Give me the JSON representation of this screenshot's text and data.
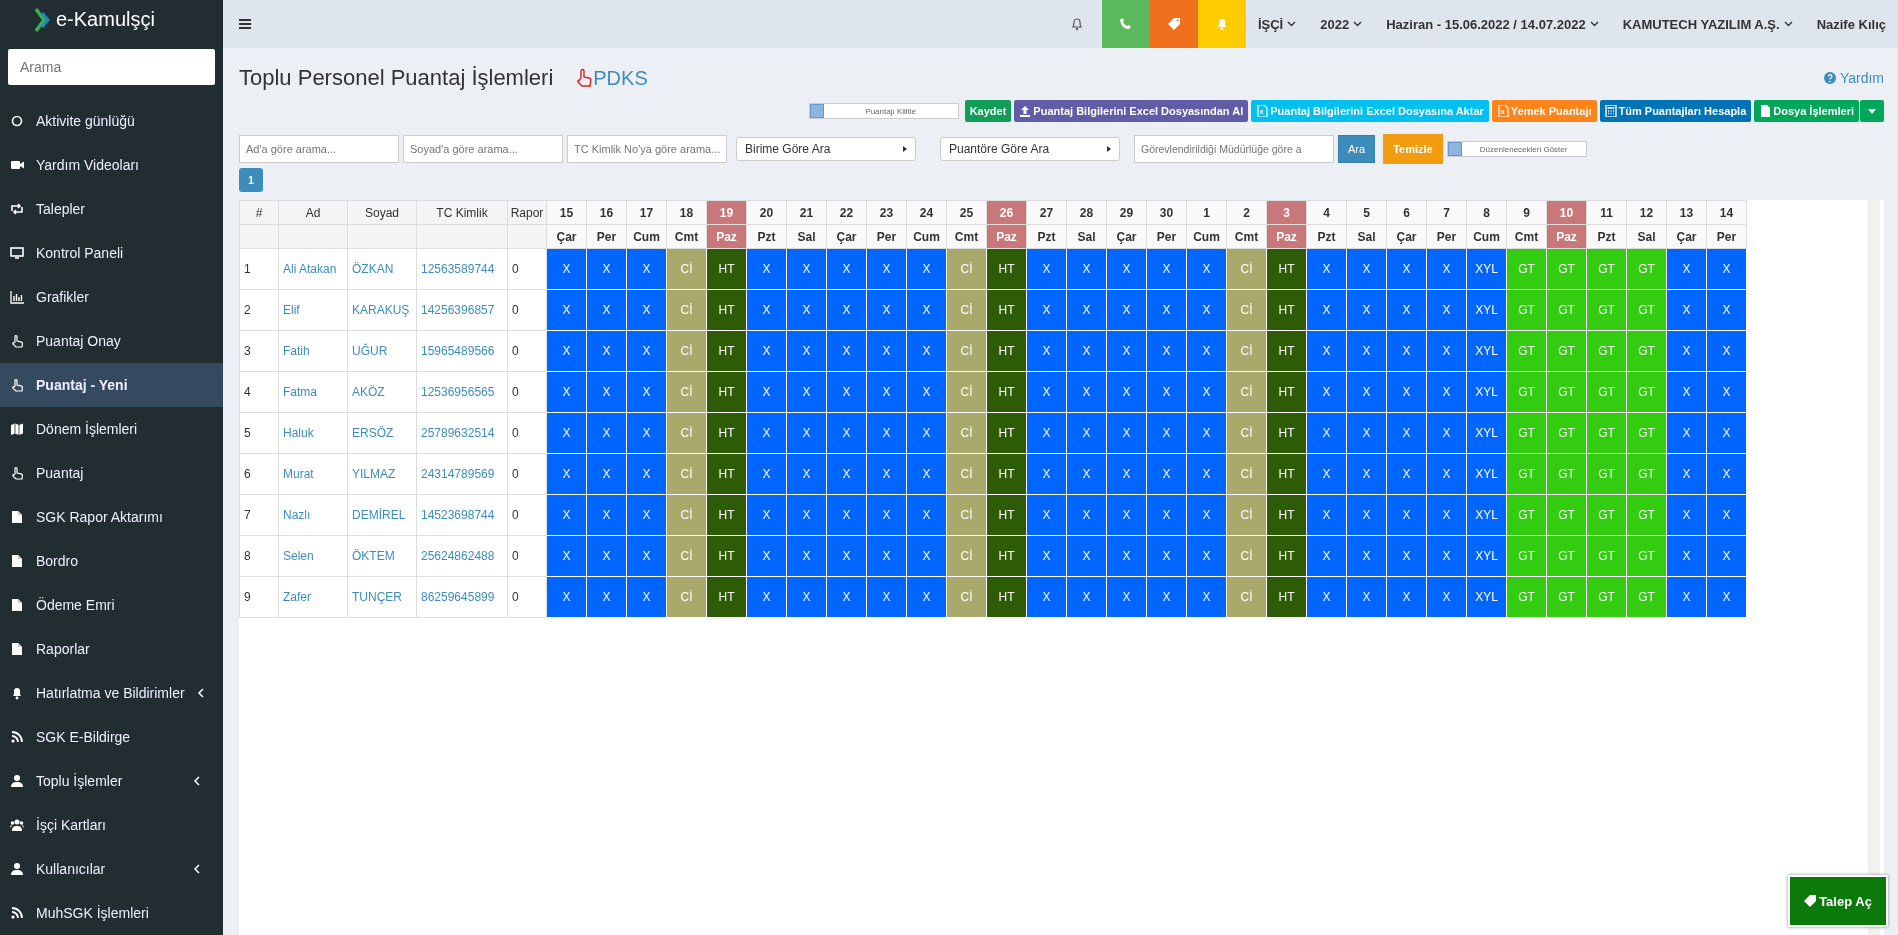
{
  "brand": {
    "name": "e-Kamulşçi"
  },
  "sidebar": {
    "search": {
      "placeholder": "Arama"
    },
    "items": [
      {
        "label": "Aktivite günlüğü",
        "selected": false,
        "has_submenu": false
      },
      {
        "label": "Yardım Videoları",
        "selected": false,
        "has_submenu": false
      },
      {
        "label": "Talepler",
        "selected": false,
        "has_submenu": false
      },
      {
        "label": "Kontrol Paneli",
        "selected": false,
        "has_submenu": false
      },
      {
        "label": "Grafikler",
        "selected": false,
        "has_submenu": false
      },
      {
        "label": "Puantaj Onay",
        "selected": false,
        "has_submenu": false
      },
      {
        "label": "Puantaj - Yeni",
        "selected": true,
        "has_submenu": false
      },
      {
        "label": "Dönem İşlemleri",
        "selected": false,
        "has_submenu": false
      },
      {
        "label": "Puantaj",
        "selected": false,
        "has_submenu": false
      },
      {
        "label": "SGK Rapor Aktarımı",
        "selected": false,
        "has_submenu": false
      },
      {
        "label": "Bordro",
        "selected": false,
        "has_submenu": false
      },
      {
        "label": "Ödeme Emri",
        "selected": false,
        "has_submenu": false
      },
      {
        "label": "Raporlar",
        "selected": false,
        "has_submenu": false
      },
      {
        "label": "Hatırlatma ve Bildirimler",
        "selected": false,
        "has_submenu": true
      },
      {
        "label": "SGK E-Bildirge",
        "selected": false,
        "has_submenu": false
      },
      {
        "label": "Toplu İşlemler",
        "selected": false,
        "has_submenu": true
      },
      {
        "label": "İşçi Kartları",
        "selected": false,
        "has_submenu": false
      },
      {
        "label": "Kullanıcılar",
        "selected": false,
        "has_submenu": true
      },
      {
        "label": "MuhSGK İşlemleri",
        "selected": false,
        "has_submenu": false
      }
    ]
  },
  "topbar": {
    "menus": [
      {
        "label": "İŞÇİ"
      },
      {
        "label": "2022"
      },
      {
        "label": "Haziran - 15.06.2022 / 14.07.2022"
      },
      {
        "label": "KAMUTECH YAZILIM A.Ş."
      }
    ],
    "user": "Nazife Kılıç"
  },
  "page": {
    "title": "Toplu Personel Puantaj İşlemleri",
    "pdks_link": "PDKS",
    "help": "Yardım"
  },
  "toolbar": {
    "lock_toggle": {
      "label": "Puantajı Kilitle",
      "on": false
    },
    "buttons": [
      {
        "label": "Kaydet",
        "color": "#0f9d58"
      },
      {
        "label": "Puantaj Bilgilerini Excel Dosyasından Al",
        "color": "#605ca8"
      },
      {
        "label": "Puantaj Bilgilerini Excel Dosyasına Aktar",
        "color": "#00c0ef"
      },
      {
        "label": "Yemek Puantajı",
        "color": "#ff851b"
      },
      {
        "label": "Tüm Puantajları Hesapla",
        "color": "#0073b7"
      },
      {
        "label": "Dosya İşlemleri",
        "color": "#00a65a"
      }
    ]
  },
  "filters": {
    "fields": [
      {
        "placeholder": "Ad'a göre arama..."
      },
      {
        "placeholder": "Soyad'a göre arama..."
      },
      {
        "placeholder": "TC Kimlik No'ya göre arama..."
      }
    ],
    "selects": [
      {
        "label": "Birime Göre Ara"
      },
      {
        "label": "Puantöre Göre Ara"
      }
    ],
    "manager_field": {
      "placeholder": "Görevlendirildiği Müdürlüğe göre a"
    },
    "search_button": "Ara",
    "clear_button": "Temizle",
    "show_toggle": {
      "label": "Düzenlenecekleri Göster",
      "on": false
    }
  },
  "pagination": [
    {
      "label": "1",
      "selected": true
    }
  ],
  "table": {
    "columns": [
      "#",
      "Ad",
      "Soyad",
      "TC Kimlik",
      "Rapor"
    ],
    "days": [
      {
        "day": "15",
        "weekday": "Çar",
        "holiday": false
      },
      {
        "day": "16",
        "weekday": "Per",
        "holiday": false
      },
      {
        "day": "17",
        "weekday": "Cum",
        "holiday": false
      },
      {
        "day": "18",
        "weekday": "Cmt",
        "holiday": false
      },
      {
        "day": "19",
        "weekday": "Paz",
        "holiday": true
      },
      {
        "day": "20",
        "weekday": "Pzt",
        "holiday": false
      },
      {
        "day": "21",
        "weekday": "Sal",
        "holiday": false
      },
      {
        "day": "22",
        "weekday": "Çar",
        "holiday": false
      },
      {
        "day": "23",
        "weekday": "Per",
        "holiday": false
      },
      {
        "day": "24",
        "weekday": "Cum",
        "holiday": false
      },
      {
        "day": "25",
        "weekday": "Cmt",
        "holiday": false
      },
      {
        "day": "26",
        "weekday": "Paz",
        "holiday": true
      },
      {
        "day": "27",
        "weekday": "Pzt",
        "holiday": false
      },
      {
        "day": "28",
        "weekday": "Sal",
        "holiday": false
      },
      {
        "day": "29",
        "weekday": "Çar",
        "holiday": false
      },
      {
        "day": "30",
        "weekday": "Per",
        "holiday": false
      },
      {
        "day": "1",
        "weekday": "Cum",
        "holiday": false
      },
      {
        "day": "2",
        "weekday": "Cmt",
        "holiday": false
      },
      {
        "day": "3",
        "weekday": "Paz",
        "holiday": true
      },
      {
        "day": "4",
        "weekday": "Pzt",
        "holiday": false
      },
      {
        "day": "5",
        "weekday": "Sal",
        "holiday": false
      },
      {
        "day": "6",
        "weekday": "Çar",
        "holiday": false
      },
      {
        "day": "7",
        "weekday": "Per",
        "holiday": false
      },
      {
        "day": "8",
        "weekday": "Cum",
        "holiday": false
      },
      {
        "day": "9",
        "weekday": "Cmt",
        "holiday": false
      },
      {
        "day": "10",
        "weekday": "Paz",
        "holiday": true
      },
      {
        "day": "11",
        "weekday": "Pzt",
        "holiday": false
      },
      {
        "day": "12",
        "weekday": "Sal",
        "holiday": false
      },
      {
        "day": "13",
        "weekday": "Çar",
        "holiday": false
      },
      {
        "day": "14",
        "weekday": "Per",
        "holiday": false
      }
    ],
    "rows": [
      {
        "no": "1",
        "ad": "Ali Atakan",
        "soyad": "ÖZKAN",
        "tc": "12563589744",
        "rapor": "0",
        "cells": [
          {
            "code": "X",
            "color": "#0066ff"
          },
          {
            "code": "X",
            "color": "#0066ff"
          },
          {
            "code": "X",
            "color": "#0066ff"
          },
          {
            "code": "Cİ",
            "color": "#a9a96c"
          },
          {
            "code": "HT",
            "color": "#2e5b06"
          },
          {
            "code": "X",
            "color": "#0066ff"
          },
          {
            "code": "X",
            "color": "#0066ff"
          },
          {
            "code": "X",
            "color": "#0066ff"
          },
          {
            "code": "X",
            "color": "#0066ff"
          },
          {
            "code": "X",
            "color": "#0066ff"
          },
          {
            "code": "Cİ",
            "color": "#a9a96c"
          },
          {
            "code": "HT",
            "color": "#2e5b06"
          },
          {
            "code": "X",
            "color": "#0066ff"
          },
          {
            "code": "X",
            "color": "#0066ff"
          },
          {
            "code": "X",
            "color": "#0066ff"
          },
          {
            "code": "X",
            "color": "#0066ff"
          },
          {
            "code": "X",
            "color": "#0066ff"
          },
          {
            "code": "Cİ",
            "color": "#a9a96c"
          },
          {
            "code": "HT",
            "color": "#2e5b06"
          },
          {
            "code": "X",
            "color": "#0066ff"
          },
          {
            "code": "X",
            "color": "#0066ff"
          },
          {
            "code": "X",
            "color": "#0066ff"
          },
          {
            "code": "X",
            "color": "#0066ff"
          },
          {
            "code": "XYL",
            "color": "#0066ff"
          },
          {
            "code": "GT",
            "color": "#33cc11"
          },
          {
            "code": "GT",
            "color": "#33cc11"
          },
          {
            "code": "GT",
            "color": "#33cc11"
          },
          {
            "code": "GT",
            "color": "#33cc11"
          },
          {
            "code": "X",
            "color": "#0066ff"
          },
          {
            "code": "X",
            "color": "#0066ff"
          }
        ]
      },
      {
        "no": "2",
        "ad": "Elif",
        "soyad": "KARAKUŞ",
        "tc": "14256396857",
        "rapor": "0",
        "cells": [
          {
            "code": "X",
            "color": "#0066ff"
          },
          {
            "code": "X",
            "color": "#0066ff"
          },
          {
            "code": "X",
            "color": "#0066ff"
          },
          {
            "code": "Cİ",
            "color": "#a9a96c"
          },
          {
            "code": "HT",
            "color": "#2e5b06"
          },
          {
            "code": "X",
            "color": "#0066ff"
          },
          {
            "code": "X",
            "color": "#0066ff"
          },
          {
            "code": "X",
            "color": "#0066ff"
          },
          {
            "code": "X",
            "color": "#0066ff"
          },
          {
            "code": "X",
            "color": "#0066ff"
          },
          {
            "code": "Cİ",
            "color": "#a9a96c"
          },
          {
            "code": "HT",
            "color": "#2e5b06"
          },
          {
            "code": "X",
            "color": "#0066ff"
          },
          {
            "code": "X",
            "color": "#0066ff"
          },
          {
            "code": "X",
            "color": "#0066ff"
          },
          {
            "code": "X",
            "color": "#0066ff"
          },
          {
            "code": "X",
            "color": "#0066ff"
          },
          {
            "code": "Cİ",
            "color": "#a9a96c"
          },
          {
            "code": "HT",
            "color": "#2e5b06"
          },
          {
            "code": "X",
            "color": "#0066ff"
          },
          {
            "code": "X",
            "color": "#0066ff"
          },
          {
            "code": "X",
            "color": "#0066ff"
          },
          {
            "code": "X",
            "color": "#0066ff"
          },
          {
            "code": "XYL",
            "color": "#0066ff"
          },
          {
            "code": "GT",
            "color": "#33cc11"
          },
          {
            "code": "GT",
            "color": "#33cc11"
          },
          {
            "code": "GT",
            "color": "#33cc11"
          },
          {
            "code": "GT",
            "color": "#33cc11"
          },
          {
            "code": "X",
            "color": "#0066ff"
          },
          {
            "code": "X",
            "color": "#0066ff"
          }
        ]
      },
      {
        "no": "3",
        "ad": "Fatih",
        "soyad": "UĞUR",
        "tc": "15965489566",
        "rapor": "0",
        "cells": [
          {
            "code": "X",
            "color": "#0066ff"
          },
          {
            "code": "X",
            "color": "#0066ff"
          },
          {
            "code": "X",
            "color": "#0066ff"
          },
          {
            "code": "Cİ",
            "color": "#a9a96c"
          },
          {
            "code": "HT",
            "color": "#2e5b06"
          },
          {
            "code": "X",
            "color": "#0066ff"
          },
          {
            "code": "X",
            "color": "#0066ff"
          },
          {
            "code": "X",
            "color": "#0066ff"
          },
          {
            "code": "X",
            "color": "#0066ff"
          },
          {
            "code": "X",
            "color": "#0066ff"
          },
          {
            "code": "Cİ",
            "color": "#a9a96c"
          },
          {
            "code": "HT",
            "color": "#2e5b06"
          },
          {
            "code": "X",
            "color": "#0066ff"
          },
          {
            "code": "X",
            "color": "#0066ff"
          },
          {
            "code": "X",
            "color": "#0066ff"
          },
          {
            "code": "X",
            "color": "#0066ff"
          },
          {
            "code": "X",
            "color": "#0066ff"
          },
          {
            "code": "Cİ",
            "color": "#a9a96c"
          },
          {
            "code": "HT",
            "color": "#2e5b06"
          },
          {
            "code": "X",
            "color": "#0066ff"
          },
          {
            "code": "X",
            "color": "#0066ff"
          },
          {
            "code": "X",
            "color": "#0066ff"
          },
          {
            "code": "X",
            "color": "#0066ff"
          },
          {
            "code": "XYL",
            "color": "#0066ff"
          },
          {
            "code": "GT",
            "color": "#33cc11"
          },
          {
            "code": "GT",
            "color": "#33cc11"
          },
          {
            "code": "GT",
            "color": "#33cc11"
          },
          {
            "code": "GT",
            "color": "#33cc11"
          },
          {
            "code": "X",
            "color": "#0066ff"
          },
          {
            "code": "X",
            "color": "#0066ff"
          }
        ]
      },
      {
        "no": "4",
        "ad": "Fatma",
        "soyad": "AKÖZ",
        "tc": "12536956565",
        "rapor": "0",
        "cells": [
          {
            "code": "X",
            "color": "#0066ff"
          },
          {
            "code": "X",
            "color": "#0066ff"
          },
          {
            "code": "X",
            "color": "#0066ff"
          },
          {
            "code": "Cİ",
            "color": "#a9a96c"
          },
          {
            "code": "HT",
            "color": "#2e5b06"
          },
          {
            "code": "X",
            "color": "#0066ff"
          },
          {
            "code": "X",
            "color": "#0066ff"
          },
          {
            "code": "X",
            "color": "#0066ff"
          },
          {
            "code": "X",
            "color": "#0066ff"
          },
          {
            "code": "X",
            "color": "#0066ff"
          },
          {
            "code": "Cİ",
            "color": "#a9a96c"
          },
          {
            "code": "HT",
            "color": "#2e5b06"
          },
          {
            "code": "X",
            "color": "#0066ff"
          },
          {
            "code": "X",
            "color": "#0066ff"
          },
          {
            "code": "X",
            "color": "#0066ff"
          },
          {
            "code": "X",
            "color": "#0066ff"
          },
          {
            "code": "X",
            "color": "#0066ff"
          },
          {
            "code": "Cİ",
            "color": "#a9a96c"
          },
          {
            "code": "HT",
            "color": "#2e5b06"
          },
          {
            "code": "X",
            "color": "#0066ff"
          },
          {
            "code": "X",
            "color": "#0066ff"
          },
          {
            "code": "X",
            "color": "#0066ff"
          },
          {
            "code": "X",
            "color": "#0066ff"
          },
          {
            "code": "XYL",
            "color": "#0066ff"
          },
          {
            "code": "GT",
            "color": "#33cc11"
          },
          {
            "code": "GT",
            "color": "#33cc11"
          },
          {
            "code": "GT",
            "color": "#33cc11"
          },
          {
            "code": "GT",
            "color": "#33cc11"
          },
          {
            "code": "X",
            "color": "#0066ff"
          },
          {
            "code": "X",
            "color": "#0066ff"
          }
        ]
      },
      {
        "no": "5",
        "ad": "Haluk",
        "soyad": "ERSÖZ",
        "tc": "25789632514",
        "rapor": "0",
        "cells": [
          {
            "code": "X",
            "color": "#0066ff"
          },
          {
            "code": "X",
            "color": "#0066ff"
          },
          {
            "code": "X",
            "color": "#0066ff"
          },
          {
            "code": "Cİ",
            "color": "#a9a96c"
          },
          {
            "code": "HT",
            "color": "#2e5b06"
          },
          {
            "code": "X",
            "color": "#0066ff"
          },
          {
            "code": "X",
            "color": "#0066ff"
          },
          {
            "code": "X",
            "color": "#0066ff"
          },
          {
            "code": "X",
            "color": "#0066ff"
          },
          {
            "code": "X",
            "color": "#0066ff"
          },
          {
            "code": "Cİ",
            "color": "#a9a96c"
          },
          {
            "code": "HT",
            "color": "#2e5b06"
          },
          {
            "code": "X",
            "color": "#0066ff"
          },
          {
            "code": "X",
            "color": "#0066ff"
          },
          {
            "code": "X",
            "color": "#0066ff"
          },
          {
            "code": "X",
            "color": "#0066ff"
          },
          {
            "code": "X",
            "color": "#0066ff"
          },
          {
            "code": "Cİ",
            "color": "#a9a96c"
          },
          {
            "code": "HT",
            "color": "#2e5b06"
          },
          {
            "code": "X",
            "color": "#0066ff"
          },
          {
            "code": "X",
            "color": "#0066ff"
          },
          {
            "code": "X",
            "color": "#0066ff"
          },
          {
            "code": "X",
            "color": "#0066ff"
          },
          {
            "code": "XYL",
            "color": "#0066ff"
          },
          {
            "code": "GT",
            "color": "#33cc11"
          },
          {
            "code": "GT",
            "color": "#33cc11"
          },
          {
            "code": "GT",
            "color": "#33cc11"
          },
          {
            "code": "GT",
            "color": "#33cc11"
          },
          {
            "code": "X",
            "color": "#0066ff"
          },
          {
            "code": "X",
            "color": "#0066ff"
          }
        ]
      },
      {
        "no": "6",
        "ad": "Murat",
        "soyad": "YILMAZ",
        "tc": "24314789569",
        "rapor": "0",
        "cells": [
          {
            "code": "X",
            "color": "#0066ff"
          },
          {
            "code": "X",
            "color": "#0066ff"
          },
          {
            "code": "X",
            "color": "#0066ff"
          },
          {
            "code": "Cİ",
            "color": "#a9a96c"
          },
          {
            "code": "HT",
            "color": "#2e5b06"
          },
          {
            "code": "X",
            "color": "#0066ff"
          },
          {
            "code": "X",
            "color": "#0066ff"
          },
          {
            "code": "X",
            "color": "#0066ff"
          },
          {
            "code": "X",
            "color": "#0066ff"
          },
          {
            "code": "X",
            "color": "#0066ff"
          },
          {
            "code": "Cİ",
            "color": "#a9a96c"
          },
          {
            "code": "HT",
            "color": "#2e5b06"
          },
          {
            "code": "X",
            "color": "#0066ff"
          },
          {
            "code": "X",
            "color": "#0066ff"
          },
          {
            "code": "X",
            "color": "#0066ff"
          },
          {
            "code": "X",
            "color": "#0066ff"
          },
          {
            "code": "X",
            "color": "#0066ff"
          },
          {
            "code": "Cİ",
            "color": "#a9a96c"
          },
          {
            "code": "HT",
            "color": "#2e5b06"
          },
          {
            "code": "X",
            "color": "#0066ff"
          },
          {
            "code": "X",
            "color": "#0066ff"
          },
          {
            "code": "X",
            "color": "#0066ff"
          },
          {
            "code": "X",
            "color": "#0066ff"
          },
          {
            "code": "XYL",
            "color": "#0066ff"
          },
          {
            "code": "GT",
            "color": "#33cc11"
          },
          {
            "code": "GT",
            "color": "#33cc11"
          },
          {
            "code": "GT",
            "color": "#33cc11"
          },
          {
            "code": "GT",
            "color": "#33cc11"
          },
          {
            "code": "X",
            "color": "#0066ff"
          },
          {
            "code": "X",
            "color": "#0066ff"
          }
        ]
      },
      {
        "no": "7",
        "ad": "Nazlı",
        "soyad": "DEMİREL",
        "tc": "14523698744",
        "rapor": "0",
        "cells": [
          {
            "code": "X",
            "color": "#0066ff"
          },
          {
            "code": "X",
            "color": "#0066ff"
          },
          {
            "code": "X",
            "color": "#0066ff"
          },
          {
            "code": "Cİ",
            "color": "#a9a96c"
          },
          {
            "code": "HT",
            "color": "#2e5b06"
          },
          {
            "code": "X",
            "color": "#0066ff"
          },
          {
            "code": "X",
            "color": "#0066ff"
          },
          {
            "code": "X",
            "color": "#0066ff"
          },
          {
            "code": "X",
            "color": "#0066ff"
          },
          {
            "code": "X",
            "color": "#0066ff"
          },
          {
            "code": "Cİ",
            "color": "#a9a96c"
          },
          {
            "code": "HT",
            "color": "#2e5b06"
          },
          {
            "code": "X",
            "color": "#0066ff"
          },
          {
            "code": "X",
            "color": "#0066ff"
          },
          {
            "code": "X",
            "color": "#0066ff"
          },
          {
            "code": "X",
            "color": "#0066ff"
          },
          {
            "code": "X",
            "color": "#0066ff"
          },
          {
            "code": "Cİ",
            "color": "#a9a96c"
          },
          {
            "code": "HT",
            "color": "#2e5b06"
          },
          {
            "code": "X",
            "color": "#0066ff"
          },
          {
            "code": "X",
            "color": "#0066ff"
          },
          {
            "code": "X",
            "color": "#0066ff"
          },
          {
            "code": "X",
            "color": "#0066ff"
          },
          {
            "code": "XYL",
            "color": "#0066ff"
          },
          {
            "code": "GT",
            "color": "#33cc11"
          },
          {
            "code": "GT",
            "color": "#33cc11"
          },
          {
            "code": "GT",
            "color": "#33cc11"
          },
          {
            "code": "GT",
            "color": "#33cc11"
          },
          {
            "code": "X",
            "color": "#0066ff"
          },
          {
            "code": "X",
            "color": "#0066ff"
          }
        ]
      },
      {
        "no": "8",
        "ad": "Selen",
        "soyad": "ÖKTEM",
        "tc": "25624862488",
        "rapor": "0",
        "cells": [
          {
            "code": "X",
            "color": "#0066ff"
          },
          {
            "code": "X",
            "color": "#0066ff"
          },
          {
            "code": "X",
            "color": "#0066ff"
          },
          {
            "code": "Cİ",
            "color": "#a9a96c"
          },
          {
            "code": "HT",
            "color": "#2e5b06"
          },
          {
            "code": "X",
            "color": "#0066ff"
          },
          {
            "code": "X",
            "color": "#0066ff"
          },
          {
            "code": "X",
            "color": "#0066ff"
          },
          {
            "code": "X",
            "color": "#0066ff"
          },
          {
            "code": "X",
            "color": "#0066ff"
          },
          {
            "code": "Cİ",
            "color": "#a9a96c"
          },
          {
            "code": "HT",
            "color": "#2e5b06"
          },
          {
            "code": "X",
            "color": "#0066ff"
          },
          {
            "code": "X",
            "color": "#0066ff"
          },
          {
            "code": "X",
            "color": "#0066ff"
          },
          {
            "code": "X",
            "color": "#0066ff"
          },
          {
            "code": "X",
            "color": "#0066ff"
          },
          {
            "code": "Cİ",
            "color": "#a9a96c"
          },
          {
            "code": "HT",
            "color": "#2e5b06"
          },
          {
            "code": "X",
            "color": "#0066ff"
          },
          {
            "code": "X",
            "color": "#0066ff"
          },
          {
            "code": "X",
            "color": "#0066ff"
          },
          {
            "code": "X",
            "color": "#0066ff"
          },
          {
            "code": "XYL",
            "color": "#0066ff"
          },
          {
            "code": "GT",
            "color": "#33cc11"
          },
          {
            "code": "GT",
            "color": "#33cc11"
          },
          {
            "code": "GT",
            "color": "#33cc11"
          },
          {
            "code": "GT",
            "color": "#33cc11"
          },
          {
            "code": "X",
            "color": "#0066ff"
          },
          {
            "code": "X",
            "color": "#0066ff"
          }
        ]
      },
      {
        "no": "9",
        "ad": "Zafer",
        "soyad": "TUNÇER",
        "tc": "86259645899",
        "rapor": "0",
        "cells": [
          {
            "code": "X",
            "color": "#0066ff"
          },
          {
            "code": "X",
            "color": "#0066ff"
          },
          {
            "code": "X",
            "color": "#0066ff"
          },
          {
            "code": "Cİ",
            "color": "#a9a96c"
          },
          {
            "code": "HT",
            "color": "#2e5b06"
          },
          {
            "code": "X",
            "color": "#0066ff"
          },
          {
            "code": "X",
            "color": "#0066ff"
          },
          {
            "code": "X",
            "color": "#0066ff"
          },
          {
            "code": "X",
            "color": "#0066ff"
          },
          {
            "code": "X",
            "color": "#0066ff"
          },
          {
            "code": "Cİ",
            "color": "#a9a96c"
          },
          {
            "code": "HT",
            "color": "#2e5b06"
          },
          {
            "code": "X",
            "color": "#0066ff"
          },
          {
            "code": "X",
            "color": "#0066ff"
          },
          {
            "code": "X",
            "color": "#0066ff"
          },
          {
            "code": "X",
            "color": "#0066ff"
          },
          {
            "code": "X",
            "color": "#0066ff"
          },
          {
            "code": "Cİ",
            "color": "#a9a96c"
          },
          {
            "code": "HT",
            "color": "#2e5b06"
          },
          {
            "code": "X",
            "color": "#0066ff"
          },
          {
            "code": "X",
            "color": "#0066ff"
          },
          {
            "code": "X",
            "color": "#0066ff"
          },
          {
            "code": "X",
            "color": "#0066ff"
          },
          {
            "code": "XYL",
            "color": "#0066ff"
          },
          {
            "code": "GT",
            "color": "#33cc11"
          },
          {
            "code": "GT",
            "color": "#33cc11"
          },
          {
            "code": "GT",
            "color": "#33cc11"
          },
          {
            "code": "GT",
            "color": "#33cc11"
          },
          {
            "code": "X",
            "color": "#0066ff"
          },
          {
            "code": "X",
            "color": "#0066ff"
          }
        ]
      }
    ]
  },
  "talep_button": "Talep Aç"
}
